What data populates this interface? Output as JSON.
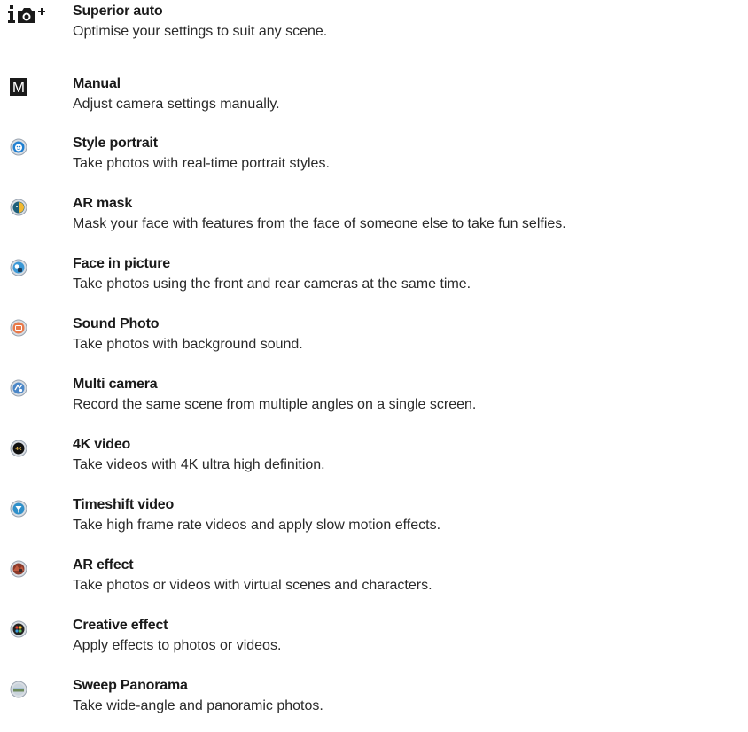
{
  "modes": [
    {
      "icon": "superior-auto-icon",
      "title": "Superior auto",
      "description": "Optimise your settings to suit any scene."
    },
    {
      "icon": "manual-icon",
      "title": "Manual",
      "description": "Adjust camera settings manually."
    },
    {
      "icon": "style-portrait-icon",
      "title": "Style portrait",
      "description": "Take photos with real-time portrait styles."
    },
    {
      "icon": "ar-mask-icon",
      "title": "AR mask",
      "description": "Mask your face with features from the face of someone else to take fun selfies."
    },
    {
      "icon": "face-in-picture-icon",
      "title": "Face in picture",
      "description": "Take photos using the front and rear cameras at the same time."
    },
    {
      "icon": "sound-photo-icon",
      "title": "Sound Photo",
      "description": "Take photos with background sound."
    },
    {
      "icon": "multi-camera-icon",
      "title": "Multi camera",
      "description": "Record the same scene from multiple angles on a single screen."
    },
    {
      "icon": "4k-video-icon",
      "title": "4K video",
      "description": "Take videos with 4K ultra high definition."
    },
    {
      "icon": "timeshift-video-icon",
      "title": "Timeshift video",
      "description": "Take high frame rate videos and apply slow motion effects."
    },
    {
      "icon": "ar-effect-icon",
      "title": "AR effect",
      "description": "Take photos or videos with virtual scenes and characters."
    },
    {
      "icon": "creative-effect-icon",
      "title": "Creative effect",
      "description": "Apply effects to photos or videos."
    },
    {
      "icon": "sweep-panorama-icon",
      "title": "Sweep Panorama",
      "description": "Take wide-angle and panoramic photos."
    }
  ],
  "icon_labels": {
    "manual": "M",
    "four_k": "4K"
  }
}
